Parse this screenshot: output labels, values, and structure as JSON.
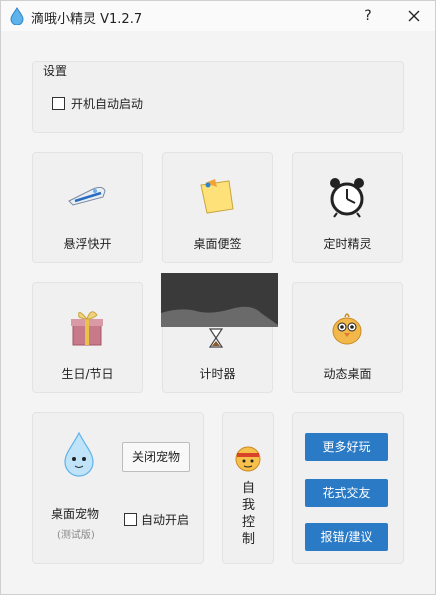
{
  "app": {
    "title": "滴哦小精灵 V1.2.7",
    "help_label": "?"
  },
  "settings": {
    "title": "设置",
    "autostart_label": "开机自动启动",
    "autostart_checked": false
  },
  "tiles": [
    {
      "label": "悬浮快开",
      "icon": "bullet-train-icon"
    },
    {
      "label": "桌面便签",
      "icon": "sticky-note-icon"
    },
    {
      "label": "定时精灵",
      "icon": "alarm-clock-icon"
    },
    {
      "label": "生日/节日",
      "icon": "gift-box-icon"
    },
    {
      "label": "计时器",
      "icon": "hourglass-icon"
    },
    {
      "label": "动态桌面",
      "icon": "chick-icon"
    }
  ],
  "pet": {
    "title": "桌面宠物",
    "subtitle": "(测试版)",
    "close_label": "关闭宠物",
    "auto_label": "自动开启",
    "auto_checked": false
  },
  "self_control": {
    "label": [
      "自",
      "我",
      "控",
      "制"
    ]
  },
  "links": {
    "more_fun": "更多好玩",
    "social": "花式交友",
    "feedback": "报错/建议"
  },
  "colors": {
    "accent": "#2a7ac6",
    "background": "#f0f0f0"
  }
}
